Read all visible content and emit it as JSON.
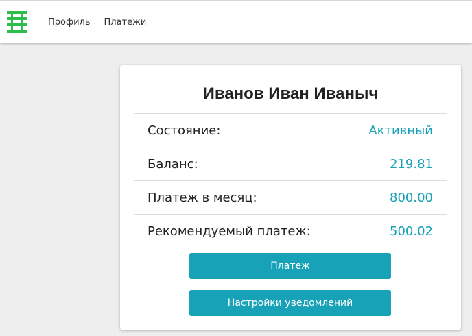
{
  "nav": {
    "logo_icon": "green-stripes-logo-icon",
    "links": [
      "Профиль",
      "Платежи"
    ]
  },
  "card": {
    "title": "Иванов Иван Иваныч",
    "rows": [
      {
        "label": "Состояние:",
        "value": "Активный"
      },
      {
        "label": "Баланс:",
        "value": "219.81"
      },
      {
        "label": "Платеж в месяц:",
        "value": "800.00"
      },
      {
        "label": "Рекомендуемый платеж:",
        "value": "500.02"
      }
    ],
    "buttons": {
      "pay": "Платеж",
      "notifications": "Настройки уведомлений"
    }
  },
  "colors": {
    "accent": "#17a2b8",
    "logo": "#2fbd4c",
    "background": "#eeeeee"
  }
}
